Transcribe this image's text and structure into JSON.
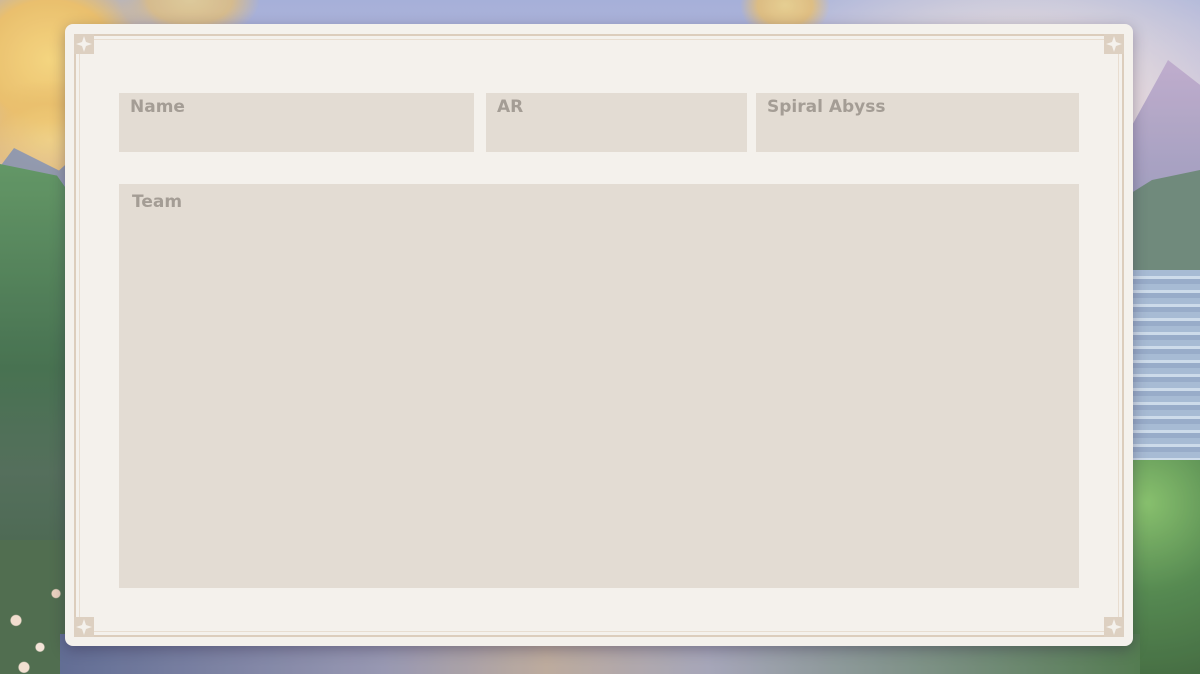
{
  "form": {
    "name_label": "Name",
    "ar_label": "AR",
    "abyss_label": "Spiral Abyss",
    "team_label": "Team"
  },
  "card": {
    "background_color": "#f4f1ec",
    "field_color": "#e3dcd3",
    "label_color": "#a49d95",
    "border_color": "#dccdbc"
  }
}
